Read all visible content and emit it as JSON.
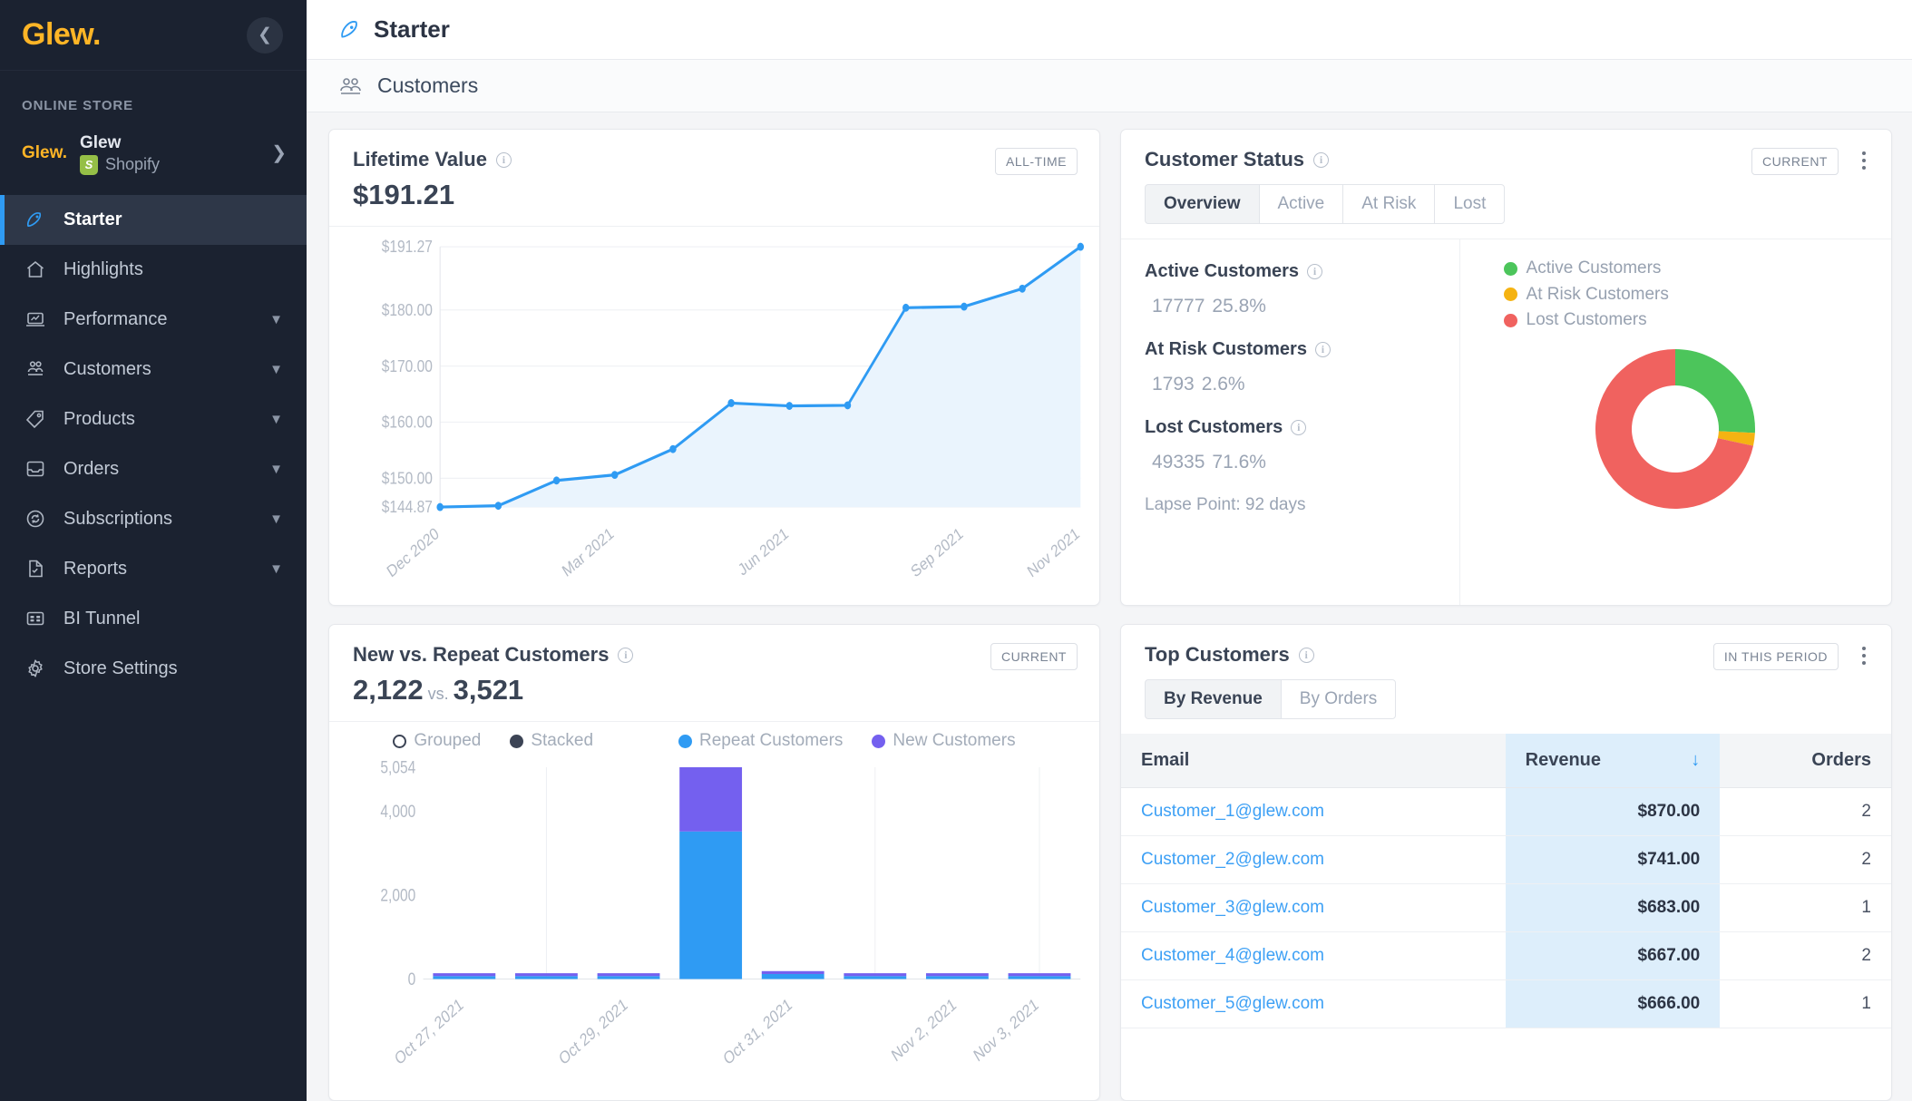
{
  "sidebar": {
    "logo": "Glew.",
    "collapse_icon": "chevron-left",
    "section_label": "ONLINE STORE",
    "store": {
      "logo": "Glew.",
      "name": "Glew",
      "platform": "Shopify"
    },
    "items": [
      {
        "label": "Starter",
        "icon": "rocket-icon",
        "active": true,
        "expandable": false
      },
      {
        "label": "Highlights",
        "icon": "home-icon",
        "active": false,
        "expandable": false
      },
      {
        "label": "Performance",
        "icon": "laptop-chart-icon",
        "active": false,
        "expandable": true
      },
      {
        "label": "Customers",
        "icon": "people-icon",
        "active": false,
        "expandable": true
      },
      {
        "label": "Products",
        "icon": "tag-icon",
        "active": false,
        "expandable": true
      },
      {
        "label": "Orders",
        "icon": "inbox-icon",
        "active": false,
        "expandable": true
      },
      {
        "label": "Subscriptions",
        "icon": "refresh-circle-icon",
        "active": false,
        "expandable": true
      },
      {
        "label": "Reports",
        "icon": "document-icon",
        "active": false,
        "expandable": true
      },
      {
        "label": "BI Tunnel",
        "icon": "grid-card-icon",
        "active": false,
        "expandable": false
      },
      {
        "label": "Store Settings",
        "icon": "gear-icon",
        "active": false,
        "expandable": false
      }
    ]
  },
  "topbar": {
    "title": "Starter",
    "icon": "rocket-icon"
  },
  "subbar": {
    "title": "Customers",
    "icon": "people-icon"
  },
  "ltv_card": {
    "title": "Lifetime Value",
    "value": "$191.21",
    "pill": "ALL-TIME"
  },
  "status_card": {
    "title": "Customer Status",
    "pill": "CURRENT",
    "tabs": [
      {
        "label": "Overview",
        "active": true
      },
      {
        "label": "Active",
        "active": false
      },
      {
        "label": "At Risk",
        "active": false
      },
      {
        "label": "Lost",
        "active": false
      }
    ],
    "metrics": [
      {
        "label": "Active Customers",
        "value": "17777",
        "pct": "25.8%"
      },
      {
        "label": "At Risk Customers",
        "value": "1793",
        "pct": "2.6%"
      },
      {
        "label": "Lost Customers",
        "value": "49335",
        "pct": "71.6%"
      }
    ],
    "lapse": "Lapse Point: 92 days",
    "legend": [
      {
        "label": "Active Customers",
        "color": "#4cc55b"
      },
      {
        "label": "At Risk Customers",
        "color": "#f5b312"
      },
      {
        "label": "Lost Customers",
        "color": "#f0625f"
      }
    ]
  },
  "newrepeat_card": {
    "title": "New vs. Repeat Customers",
    "value_new": "2,122",
    "vs": "vs.",
    "value_repeat": "3,521",
    "pill": "CURRENT",
    "legend": [
      {
        "label": "Grouped",
        "type": "ring",
        "color": "#3c4455"
      },
      {
        "label": "Stacked",
        "type": "solid",
        "color": "#3c4455"
      },
      {
        "label": "Repeat Customers",
        "type": "solid",
        "color": "#2f9bf3"
      },
      {
        "label": "New Customers",
        "type": "solid",
        "color": "#7460ef"
      }
    ]
  },
  "top_customers_card": {
    "title": "Top Customers",
    "pill": "IN THIS PERIOD",
    "tabs": [
      {
        "label": "By Revenue",
        "active": true
      },
      {
        "label": "By Orders",
        "active": false
      }
    ],
    "columns": [
      "Email",
      "Revenue",
      "Orders"
    ],
    "sort_column": "Revenue",
    "sort_dir": "desc",
    "rows": [
      {
        "email": "Customer_1@glew.com",
        "revenue": "$870.00",
        "orders": "2"
      },
      {
        "email": "Customer_2@glew.com",
        "revenue": "$741.00",
        "orders": "2"
      },
      {
        "email": "Customer_3@glew.com",
        "revenue": "$683.00",
        "orders": "1"
      },
      {
        "email": "Customer_4@glew.com",
        "revenue": "$667.00",
        "orders": "2"
      },
      {
        "email": "Customer_5@glew.com",
        "revenue": "$666.00",
        "orders": "1"
      }
    ]
  },
  "chart_data": [
    {
      "type": "area",
      "name": "lifetime-value-chart",
      "title": "Lifetime Value",
      "xlabel": "",
      "ylabel": "",
      "ytick_labels": [
        "$191.27",
        "$180.00",
        "$170.00",
        "$160.00",
        "$150.00",
        "$144.87"
      ],
      "ytick_values": [
        191.27,
        180.0,
        170.0,
        160.0,
        150.0,
        144.87
      ],
      "ylim": [
        144.87,
        191.27
      ],
      "xtick_labels": [
        "Dec 2020",
        "Mar 2021",
        "Jun 2021",
        "Sep 2021",
        "Nov 2021"
      ],
      "x": [
        "Dec 2020",
        "Jan 2021",
        "Feb 2021",
        "Mar 2021",
        "Apr 2021",
        "May 2021",
        "Jun 2021",
        "Jul 2021",
        "Aug 2021",
        "Sep 2021",
        "Oct 2021",
        "Nov 2021"
      ],
      "values": [
        144.87,
        145.1,
        149.6,
        150.6,
        155.2,
        163.4,
        162.9,
        163.0,
        180.4,
        180.6,
        183.8,
        191.27
      ],
      "line_color": "#2f9bf3",
      "fill_color": "#eaf4fd",
      "grid": true,
      "legend": "none"
    },
    {
      "type": "pie",
      "name": "customer-status-donut",
      "title": "Customer Status",
      "labels": [
        "Active Customers",
        "At Risk Customers",
        "Lost Customers"
      ],
      "values": [
        25.8,
        2.6,
        71.6
      ],
      "colors": [
        "#4cc55b",
        "#f5b312",
        "#f0625f"
      ],
      "donut": true,
      "legend": "top-right"
    },
    {
      "type": "bar",
      "name": "new-vs-repeat-bar-chart",
      "title": "New vs. Repeat Customers",
      "stacked": true,
      "categories": [
        "Oct 27, 2021",
        "Oct 28, 2021",
        "Oct 29, 2021",
        "Oct 30, 2021",
        "Oct 31, 2021",
        "Nov 1, 2021",
        "Nov 2, 2021",
        "Nov 3, 2021"
      ],
      "xtick_labels": [
        "Oct 27, 2021",
        "Oct 29, 2021",
        "Oct 31, 2021",
        "Nov 2, 2021",
        "Nov 3, 2021"
      ],
      "ytick_labels": [
        "5,054",
        "4,000",
        "2,000",
        "0"
      ],
      "ytick_values": [
        5054,
        4000,
        2000,
        0
      ],
      "ylim": [
        0,
        5054
      ],
      "series": [
        {
          "name": "Repeat Customers",
          "color": "#2f9bf3",
          "values": [
            10,
            12,
            10,
            3521,
            120,
            14,
            12,
            4
          ]
        },
        {
          "name": "New Customers",
          "color": "#7460ef",
          "values": [
            12,
            14,
            12,
            1533,
            60,
            16,
            36,
            5
          ]
        }
      ],
      "grid": true,
      "legend": "top"
    }
  ]
}
